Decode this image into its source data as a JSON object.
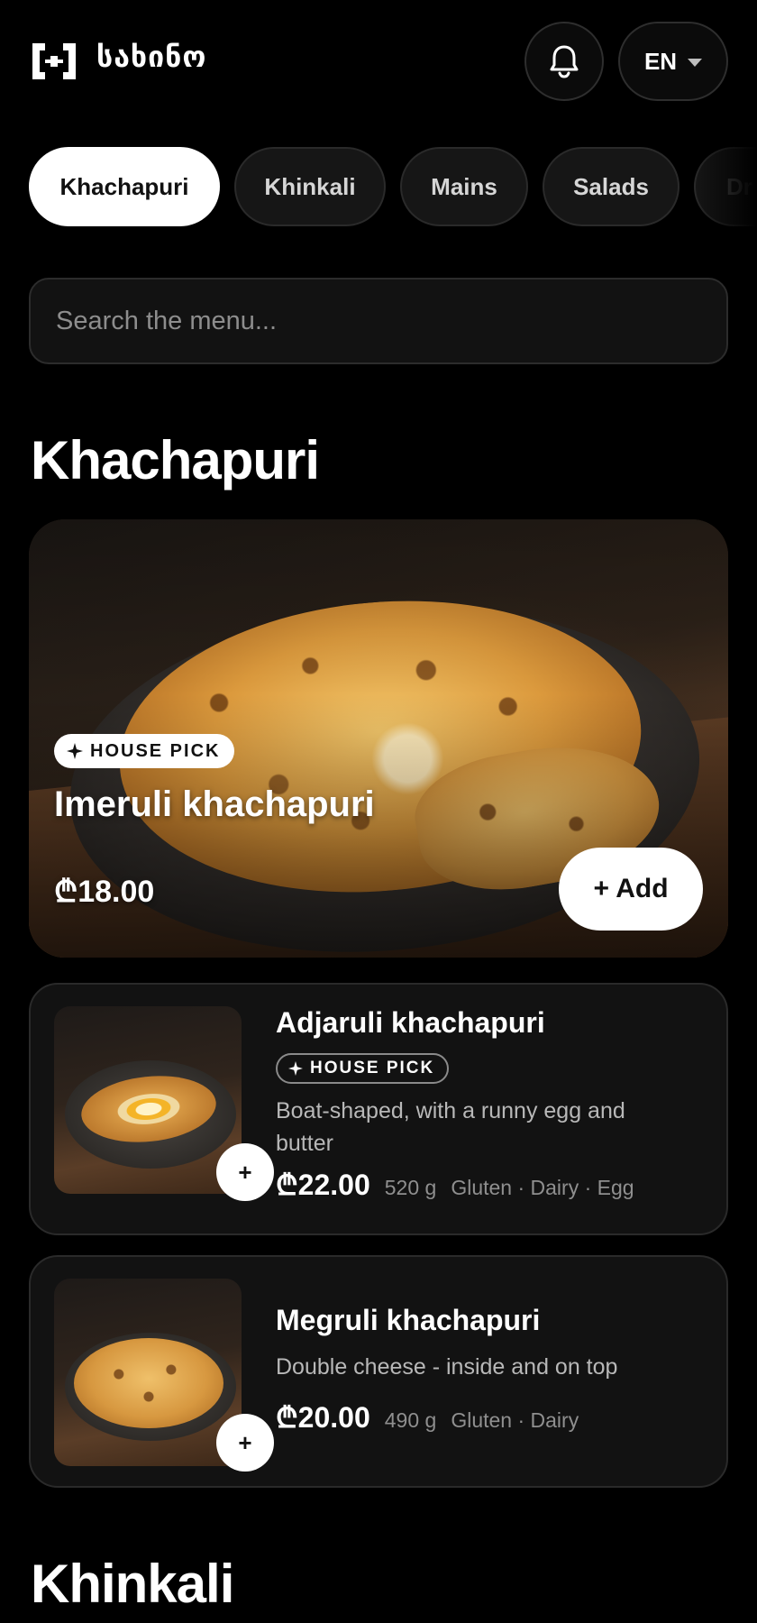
{
  "header": {
    "brand": "სახინო",
    "language": "EN"
  },
  "tabs": [
    {
      "label": "Khachapuri",
      "active": true
    },
    {
      "label": "Khinkali",
      "active": false
    },
    {
      "label": "Mains",
      "active": false
    },
    {
      "label": "Salads",
      "active": false
    },
    {
      "label": "Dr",
      "active": false
    }
  ],
  "search": {
    "placeholder": "Search the menu...",
    "value": ""
  },
  "sections": {
    "khachapuri_title": "Khachapuri",
    "khinkali_title": "Khinkali"
  },
  "hero": {
    "badge": "HOUSE PICK",
    "name": "Imeruli khachapuri",
    "price": "₾18.00",
    "add_label": "+ Add"
  },
  "items": [
    {
      "name": "Adjaruli khachapuri",
      "badge": "HOUSE PICK",
      "description": "Boat-shaped, with a runny egg and butter",
      "price": "₾22.00",
      "weight": "520 g",
      "allergens": "Gluten · Dairy · Egg",
      "add_label": "+"
    },
    {
      "name": "Megruli khachapuri",
      "description": "Double cheese - inside and on top",
      "price": "₾20.00",
      "weight": "490 g",
      "allergens": "Gluten · Dairy",
      "add_label": "+"
    }
  ],
  "icons": {
    "logo": "logo-icon",
    "bell": "bell-icon",
    "caret": "chevron-down-icon",
    "sparkle": "sparkle-icon"
  },
  "colors": {
    "background": "#000000",
    "surface": "#121212",
    "border": "#2a2a2a",
    "accent": "#ffffff"
  }
}
